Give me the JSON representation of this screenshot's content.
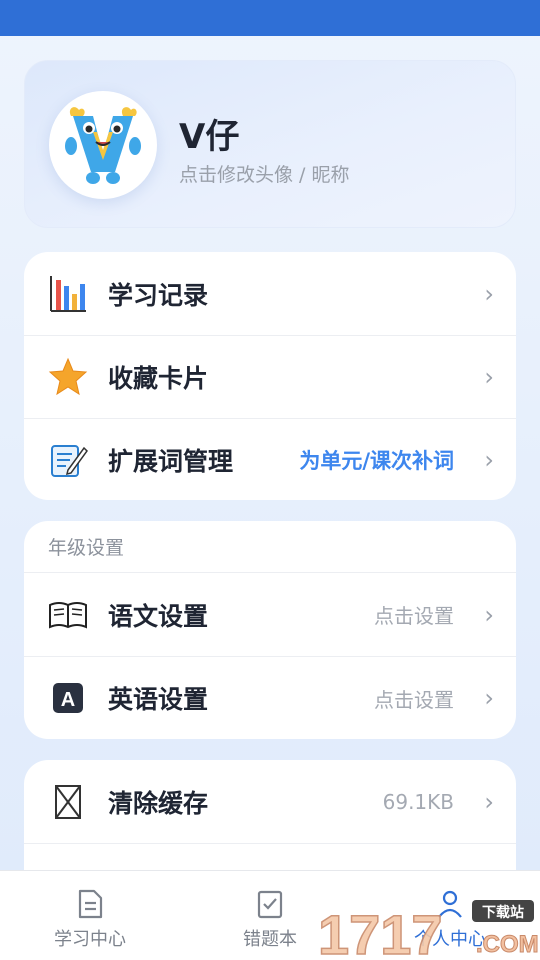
{
  "status_bar": {
    "color": "#2f6fd6"
  },
  "profile": {
    "nickname": "V仔",
    "hint": "点击修改头像 / 昵称",
    "avatar_icon": "mascot-avatar"
  },
  "menu": {
    "items": [
      {
        "label": "学习记录",
        "icon": "bar-chart-icon",
        "value": ""
      },
      {
        "label": "收藏卡片",
        "icon": "star-icon",
        "value": ""
      },
      {
        "label": "扩展词管理",
        "icon": "note-edit-icon",
        "value": "为单元/课次补词"
      }
    ]
  },
  "grade": {
    "title": "年级设置",
    "items": [
      {
        "label": "语文设置",
        "icon": "book-icon",
        "value": "点击设置"
      },
      {
        "label": "英语设置",
        "icon": "letter-a-icon",
        "value": "点击设置"
      }
    ]
  },
  "cache": {
    "label": "清除缓存",
    "icon": "hourglass-icon",
    "value": "69.1KB"
  },
  "chevron": "›",
  "tabs": [
    {
      "label": "学习中心",
      "icon": "document-icon"
    },
    {
      "label": "错题本",
      "icon": "checklist-icon"
    },
    {
      "label": "个人中心",
      "icon": "person-icon"
    }
  ],
  "watermark": {
    "text": "1717",
    "small": "下载站",
    "suffix": ".COM"
  },
  "colors": {
    "accent": "#3d86ee",
    "primary": "#2f6fd6"
  }
}
